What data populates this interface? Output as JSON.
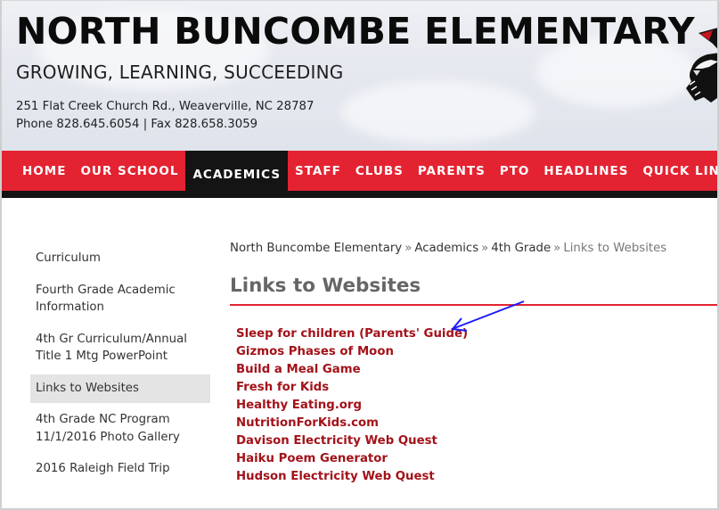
{
  "header": {
    "school_name": "NORTH BUNCOMBE ELEMENTARY",
    "motto": "GROWING, LEARNING, SUCCEEDING",
    "address": "251 Flat Creek Church Rd., Weaverville, NC 28787",
    "phone": "Phone 828.645.6054 | Fax 828.658.3059",
    "mascot_icon": "eagle-mascot-icon"
  },
  "nav": {
    "items": [
      {
        "label": "HOME",
        "active": false
      },
      {
        "label": "OUR SCHOOL",
        "active": false
      },
      {
        "label": "ACADEMICS",
        "active": true
      },
      {
        "label": "STAFF",
        "active": false
      },
      {
        "label": "CLUBS",
        "active": false
      },
      {
        "label": "PARENTS",
        "active": false
      },
      {
        "label": "PTO",
        "active": false
      },
      {
        "label": "HEADLINES",
        "active": false
      },
      {
        "label": "QUICK LINKS",
        "active": false
      }
    ]
  },
  "sidebar": {
    "items": [
      {
        "label": "Curriculum",
        "active": false
      },
      {
        "label": "Fourth Grade Academic Information",
        "active": false
      },
      {
        "label": "4th Gr Curriculum/Annual Title 1 Mtg PowerPoint",
        "active": false
      },
      {
        "label": "Links to Websites",
        "active": true
      },
      {
        "label": "4th Grade NC Program 11/1/2016 Photo Gallery",
        "active": false
      },
      {
        "label": "2016 Raleigh Field Trip",
        "active": false
      }
    ]
  },
  "breadcrumb": {
    "items": [
      "North Buncombe Elementary",
      "Academics",
      "4th Grade"
    ],
    "separator": "»",
    "current": "Links to Websites"
  },
  "main": {
    "title": "Links to Websites",
    "links": [
      "Sleep for children (Parents' Guide)",
      "Gizmos Phases of Moon",
      "Build a Meal Game",
      "Fresh for Kids",
      "Healthy Eating.org",
      "NutritionForKids.com",
      "Davison Electricity Web Quest",
      "Haiku Poem Generator",
      "Hudson Electricity Web Quest"
    ]
  },
  "annotation": {
    "arrow_color": "#1a1aff",
    "target": "Sleep for children (Parents' Guide)"
  },
  "colors": {
    "nav_red": "#e42332",
    "nav_active": "#141414",
    "link_red": "#a31219",
    "title_gray": "#666666"
  }
}
